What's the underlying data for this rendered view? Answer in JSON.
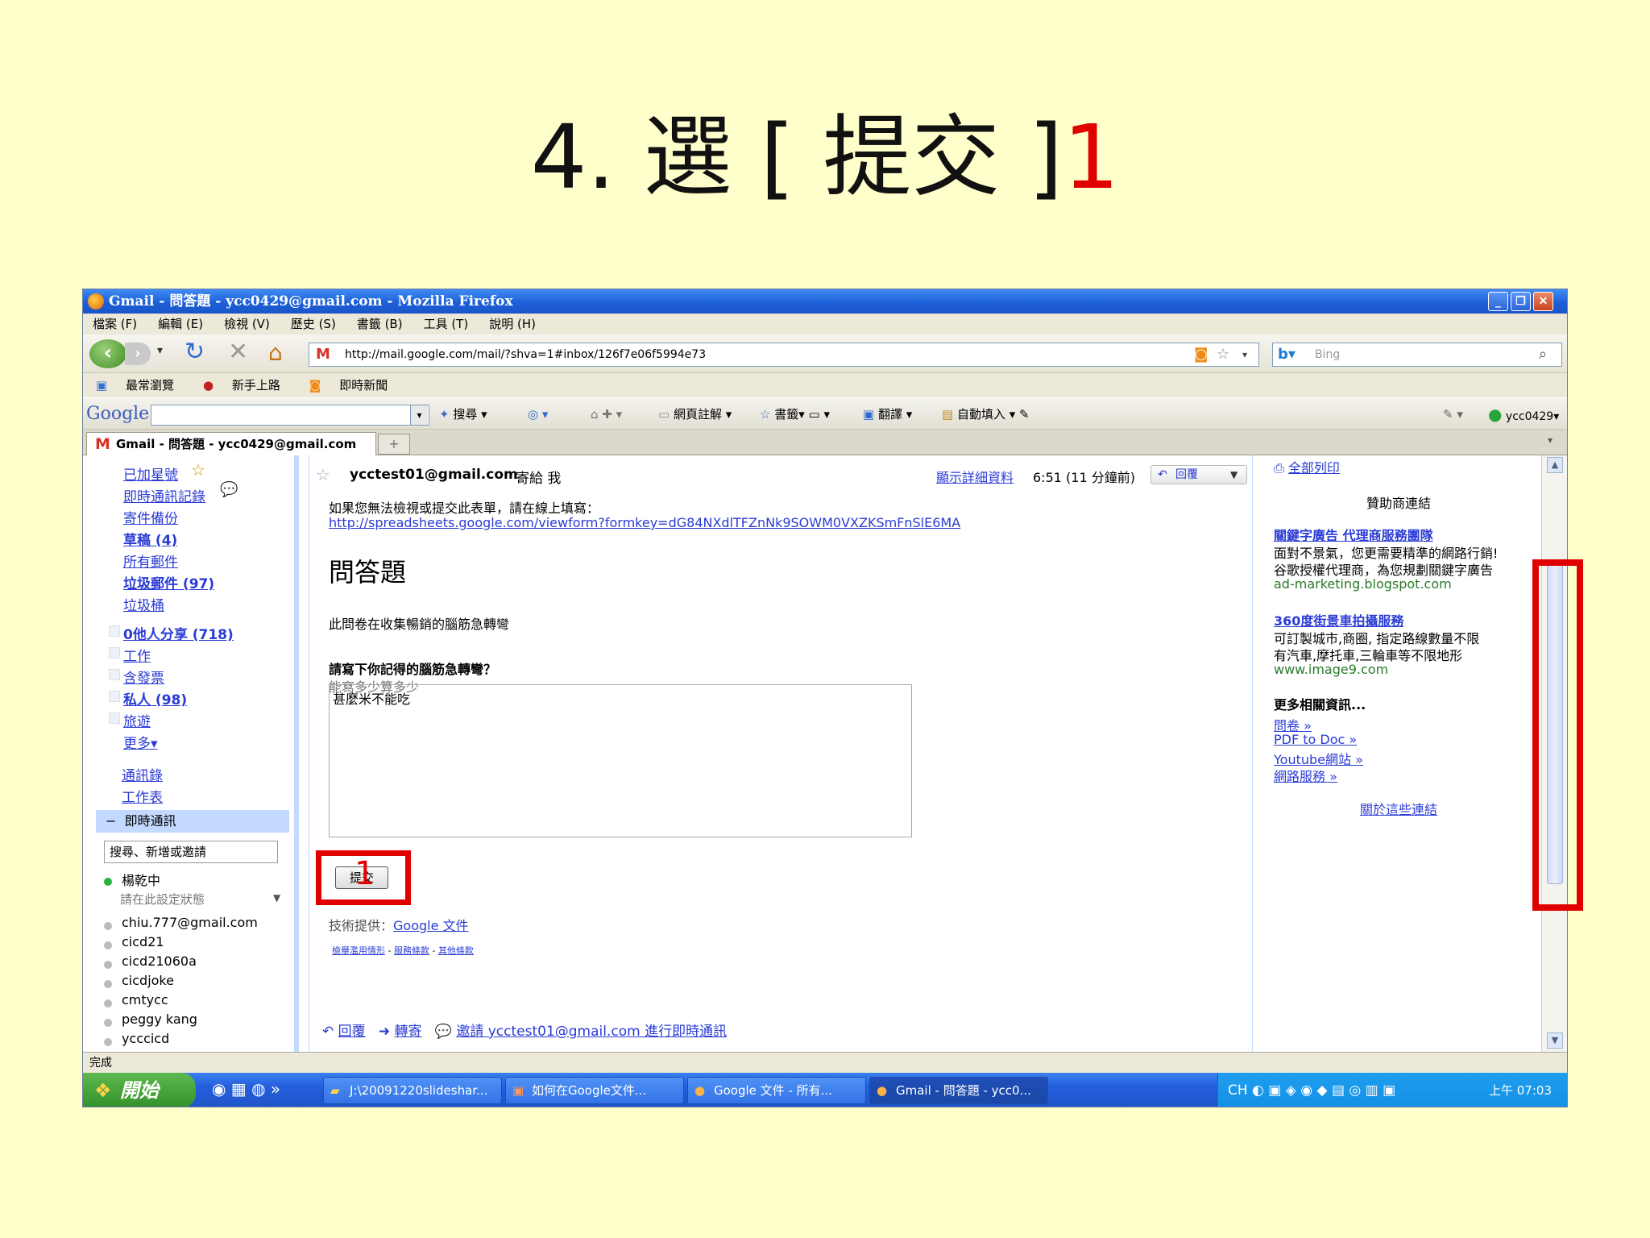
{
  "slide": {
    "title": "4. 選 [ 提交 ]",
    "title_marker": "1"
  },
  "window": {
    "title": "Gmail - 問答題 - ycc0429@gmail.com - Mozilla Firefox",
    "minimize": "_",
    "restore": "❐",
    "close": "✕"
  },
  "menu": [
    "檔案 (F)",
    "編輯 (E)",
    "檢視 (V)",
    "歷史 (S)",
    "書籤 (B)",
    "工具 (T)",
    "說明 (H)"
  ],
  "nav": {
    "url": "http://mail.google.com/mail/?shva=1#inbox/126f7e06f5994e73",
    "search_placeholder": "Bing"
  },
  "bookmarks": [
    "最常瀏覽",
    "新手上路",
    "即時新聞"
  ],
  "google_toolbar": {
    "logo": "Google",
    "search_label": "搜尋",
    "annotate": "網頁註解",
    "bookmarks": "書籤",
    "translate": "翻譯",
    "autofill": "自動填入",
    "account": "ycc0429"
  },
  "tab": {
    "label": "Gmail - 問答題 - ycc0429@gmail.com",
    "new_tab": "+"
  },
  "leftnav": {
    "items": [
      {
        "label": "已加星號",
        "bold": false
      },
      {
        "label": "即時通訊記錄",
        "bold": false
      },
      {
        "label": "寄件備份",
        "bold": false
      },
      {
        "label": "草稿 (4)",
        "bold": true
      },
      {
        "label": "所有郵件",
        "bold": false
      },
      {
        "label": "垃圾郵件 (97)",
        "bold": true
      },
      {
        "label": "垃圾桶",
        "bold": false
      }
    ],
    "labels": [
      {
        "label": "0他人分享 (718)",
        "bold": true
      },
      {
        "label": "工作",
        "bold": false
      },
      {
        "label": "含發票",
        "bold": false
      },
      {
        "label": "私人 (98)",
        "bold": true
      },
      {
        "label": "旅遊",
        "bold": false
      },
      {
        "label": "更多▾",
        "bold": false
      }
    ],
    "extras": [
      "通訊錄",
      "工作表"
    ],
    "chat_title": "即時通訊",
    "chat_search": "搜尋、新增或邀請",
    "me_name": "楊乾中",
    "status_prompt": "請在此設定狀態",
    "contacts": [
      "chiu.777@gmail.com",
      "cicd21",
      "cicd21060a",
      "cicdjoke",
      "cmtycc",
      "peggy kang",
      "ycccicd"
    ]
  },
  "message": {
    "sender": "ycctest01@gmail.com",
    "to_me": "寄給 我",
    "show_details": "顯示詳細資料",
    "time": "6:51 (11 分鐘前)",
    "reply": "回覆",
    "notice": "如果您無法檢視或提交此表單，請在線上填寫：",
    "form_link": "http://spreadsheets.google.com/viewform?formkey=dG84NXdlTFZnNk9SOWM0VXZKSmFnSlE6MA",
    "form_title": "問答題",
    "form_desc": "此問卷在收集暢銷的腦筋急轉彎",
    "question": "請寫下你記得的腦筋急轉彎？",
    "hint": "能寫多少算多少",
    "answer": "甚麼米不能吃",
    "submit": "提交",
    "submit_marker": "1",
    "powered_by": "技術提供：",
    "powered_link": "Google 文件",
    "legal_1": "檢舉濫用情形",
    "legal_2": "服務條款",
    "legal_3": "其他條款",
    "reply_link": "回覆",
    "forward_link": "轉寄",
    "invite_link": "邀請 ycctest01@gmail.com 進行即時通訊"
  },
  "ads": {
    "print_all": "全部列印",
    "sponsored": "贊助商連結",
    "ad1_title": "關鍵字廣告 代理商服務團隊",
    "ad1_line1": "面對不景氣，您更需要精準的網路行銷!",
    "ad1_line2": "谷歌授權代理商，為您規劃關鍵字廣告",
    "ad1_url": "ad-marketing.blogspot.com",
    "ad2_title": "360度街景車拍攝服務",
    "ad2_line1": "可訂製城市,商圈, 指定路線數量不限",
    "ad2_line2": "有汽車,摩托車,三輪車等不限地形",
    "ad2_url": "www.image9.com",
    "more_title": "更多相關資訊...",
    "more_links": [
      "問卷 »",
      "PDF to Doc »",
      "Youtube網站 »",
      "網路服務 »"
    ],
    "about": "關於這些連結"
  },
  "status": "完成",
  "taskbar": {
    "start": "開始",
    "items": [
      "J:\\20091220slideshar...",
      "如何在Google文件...",
      "Google 文件 - 所有...",
      "Gmail - 問答題 - ycc0..."
    ],
    "clock": "上午 07:03"
  }
}
